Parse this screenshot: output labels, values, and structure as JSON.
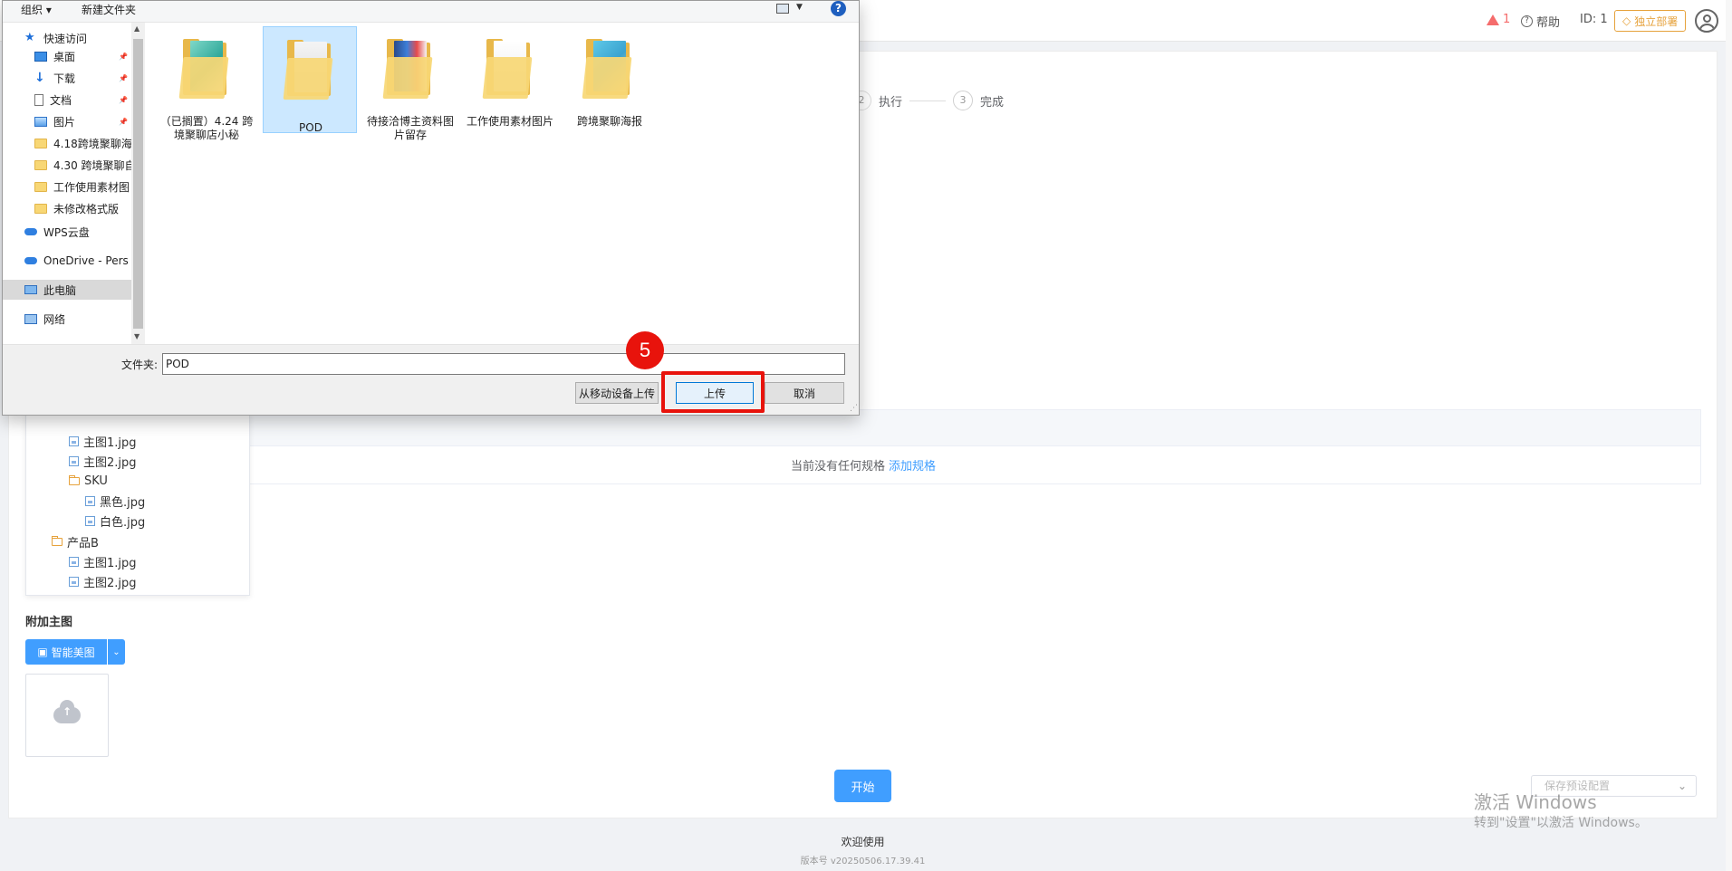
{
  "header": {
    "warning_count": "1",
    "help_label": "帮助",
    "id_label": "ID: 1",
    "deploy_label": "独立部署"
  },
  "steps": {
    "step2_label": "执行",
    "step3_num": "3",
    "step3_label": "完成"
  },
  "spec": {
    "empty_text": "当前没有任何规格",
    "add_link": "添加规格"
  },
  "tree": [
    {
      "label": "主图1.jpg",
      "type": "file",
      "level": 2
    },
    {
      "label": "主图2.jpg",
      "type": "file",
      "level": 2
    },
    {
      "label": "SKU",
      "type": "folder",
      "level": 2
    },
    {
      "label": "黑色.jpg",
      "type": "file",
      "level": 3
    },
    {
      "label": "白色.jpg",
      "type": "file",
      "level": 3
    },
    {
      "label": "产品B",
      "type": "folder",
      "level": 1
    },
    {
      "label": "主图1.jpg",
      "type": "file",
      "level": 2
    },
    {
      "label": "主图2.jpg",
      "type": "file",
      "level": 2
    }
  ],
  "extra_image": {
    "title": "附加主图",
    "smart_button": "智能美图"
  },
  "actions": {
    "start_button": "开始",
    "preset_placeholder": "保存预设配置"
  },
  "watermark": {
    "line1": "激活 Windows",
    "line2": "转到\"设置\"以激活 Windows。"
  },
  "footer": {
    "welcome": "欢迎使用",
    "version": "版本号 v20250506.17.39.41"
  },
  "dialog": {
    "toolbar": {
      "organize": "组织 ▾",
      "new_folder": "新建文件夹",
      "help": "?"
    },
    "nav": [
      {
        "label": "快速访问",
        "icon": "star-icon",
        "pinned": false
      },
      {
        "label": "桌面",
        "icon": "desktop-icon",
        "pinned": true
      },
      {
        "label": "下载",
        "icon": "download-icon",
        "pinned": true
      },
      {
        "label": "文档",
        "icon": "document-icon",
        "pinned": true
      },
      {
        "label": "图片",
        "icon": "pictures-icon",
        "pinned": true
      },
      {
        "label": "4.18跨境聚聊海",
        "icon": "folder-icon",
        "pinned": false
      },
      {
        "label": "4.30 跨境聚聊自",
        "icon": "folder-icon",
        "pinned": false
      },
      {
        "label": "工作使用素材图",
        "icon": "folder-icon",
        "pinned": false
      },
      {
        "label": "未修改格式版",
        "icon": "folder-icon",
        "pinned": false
      },
      {
        "label": "WPS云盘",
        "icon": "cloud-icon",
        "pinned": false
      },
      {
        "label": "OneDrive - Pers",
        "icon": "onedrive-icon",
        "pinned": false
      },
      {
        "label": "此电脑",
        "icon": "computer-icon",
        "pinned": false
      },
      {
        "label": "网络",
        "icon": "network-icon",
        "pinned": false
      }
    ],
    "folders": [
      {
        "label": "（已搁置）4.24 跨境聚聊店小秘"
      },
      {
        "label": "POD"
      },
      {
        "label": "待接洽博主资料图片留存"
      },
      {
        "label": "工作使用素材图片"
      },
      {
        "label": "跨境聚聊海报"
      }
    ],
    "folder_field_label": "文件夹:",
    "folder_field_value": "POD",
    "buttons": {
      "mobile_upload": "从移动设备上传",
      "upload": "上传",
      "cancel": "取消"
    }
  },
  "annotation": {
    "step_number": "5"
  },
  "colors": {
    "primary": "#409eff",
    "warning": "#f56c6c",
    "deploy": "#e6a23c",
    "annotation": "#e8130c"
  }
}
